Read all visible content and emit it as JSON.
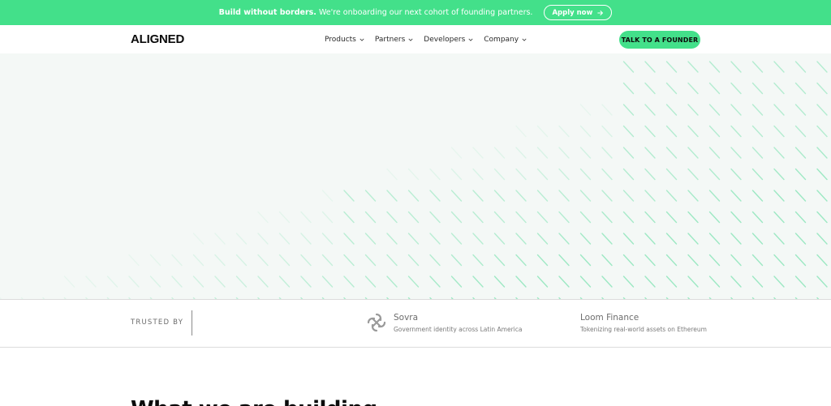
{
  "announcement": {
    "bold": "Build without borders.",
    "text": " We're onboarding our next cohort of founding partners.",
    "cta_label": "Apply now"
  },
  "nav": {
    "logo": "ALIGNED",
    "items": [
      {
        "label": "Products"
      },
      {
        "label": "Partners"
      },
      {
        "label": "Developers"
      },
      {
        "label": "Company"
      }
    ],
    "cta_label": "TALK TO A FOUNDER"
  },
  "trusted": {
    "label": "TRUSTED BY",
    "partners": [
      {
        "name": "Sovra",
        "description": "Government identity across Latin America",
        "icon": "sovra-logo-icon"
      },
      {
        "name": "Loom Finance",
        "description": "Tokenizing real-world assets on Ethereum"
      }
    ]
  },
  "section": {
    "title": "What we are building"
  },
  "colors": {
    "accent": "#43e08a",
    "hero_bg": "#f4f8f6",
    "pattern": "#7fe3b2"
  }
}
